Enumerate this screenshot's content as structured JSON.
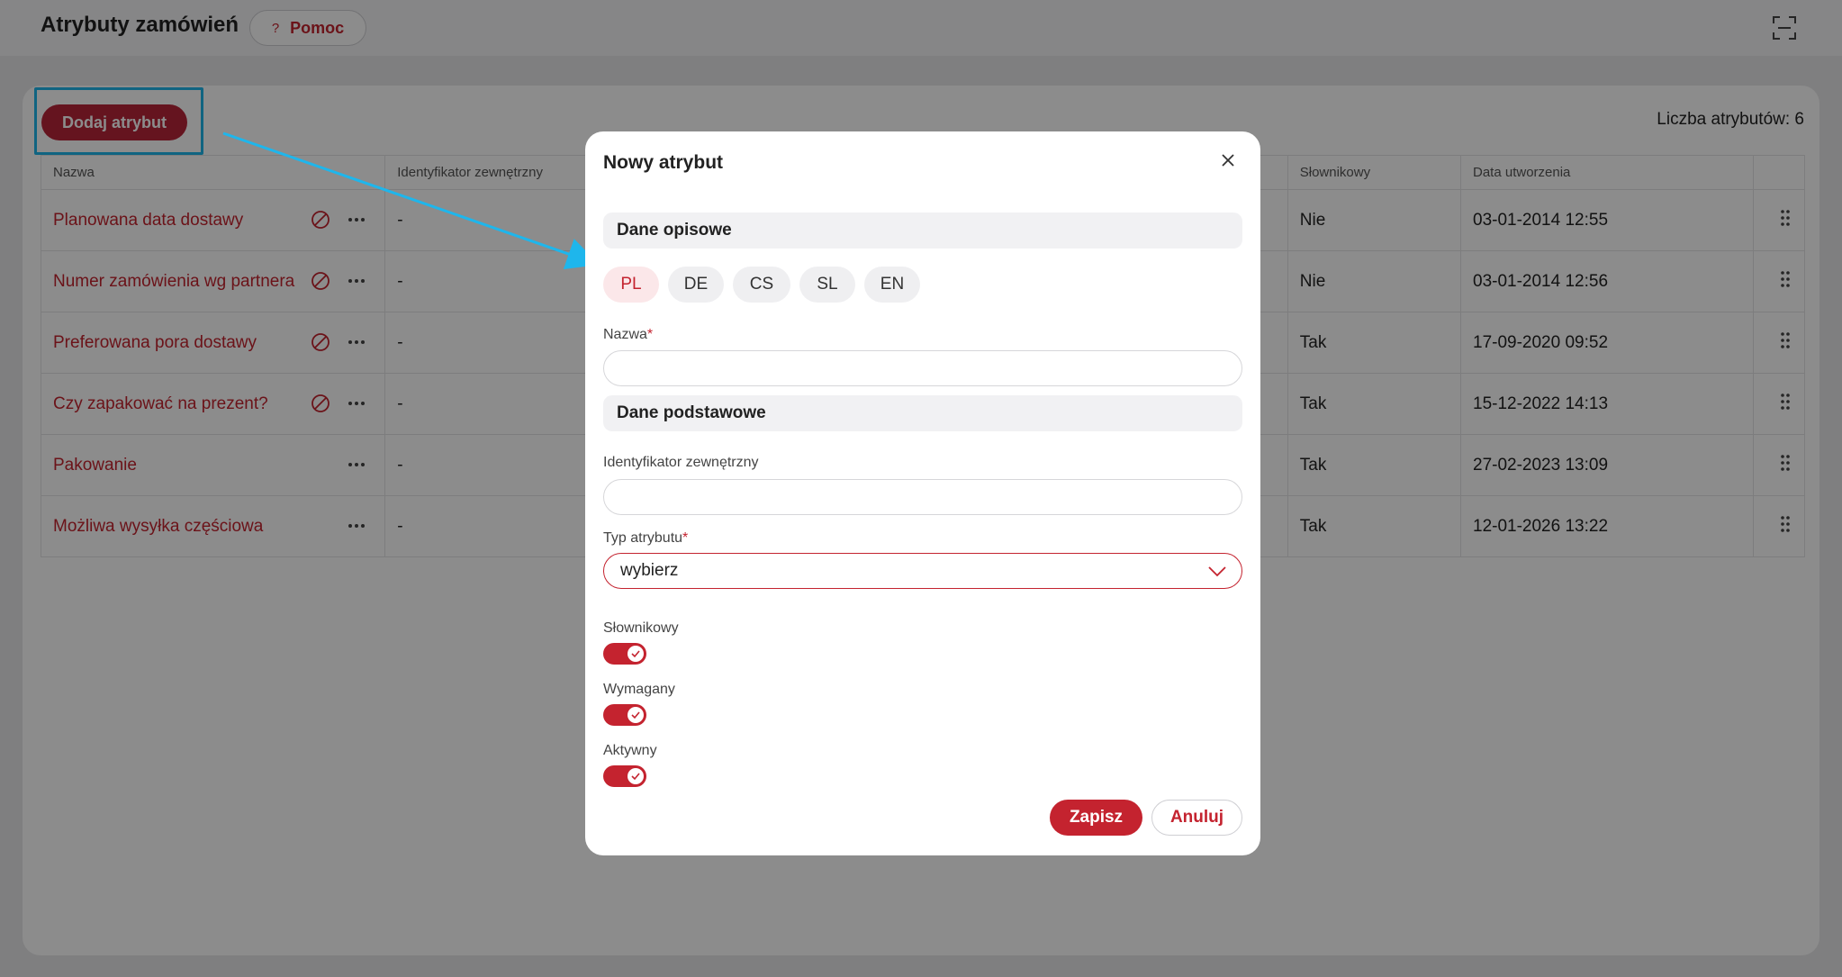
{
  "header": {
    "title": "Atrybuty zamówień",
    "help_icon": "?",
    "help_label": "Pomoc",
    "fullscreen_icon": "fullscreen-icon"
  },
  "toolbar": {
    "add_label": "Dodaj atrybut",
    "count_label": "Liczba atrybutów: 6"
  },
  "table": {
    "columns": [
      "Nazwa",
      "Identyfikator zewnętrzny",
      "",
      "Słownikowy",
      "Data utworzenia",
      ""
    ],
    "rows": [
      {
        "name": "Planowana data dostawy",
        "ext_id": "-",
        "dictionary": "Nie",
        "created": "03-01-2014 12:55",
        "disabled": true
      },
      {
        "name": "Numer zamówienia wg partnera",
        "ext_id": "-",
        "dictionary": "Nie",
        "created": "03-01-2014 12:56",
        "disabled": true
      },
      {
        "name": "Preferowana pora dostawy",
        "ext_id": "-",
        "dictionary": "Tak",
        "created": "17-09-2020 09:52",
        "disabled": true
      },
      {
        "name": "Czy zapakować na prezent?",
        "ext_id": "-",
        "dictionary": "Tak",
        "created": "15-12-2022 14:13",
        "disabled": true
      },
      {
        "name": "Pakowanie",
        "ext_id": "-",
        "dictionary": "Tak",
        "created": "27-02-2023 13:09",
        "disabled": false
      },
      {
        "name": "Możliwa wysyłka częściowa",
        "ext_id": "-",
        "dictionary": "Tak",
        "created": "12-01-2026 13:22",
        "disabled": false
      }
    ]
  },
  "modal": {
    "title": "Nowy atrybut",
    "section_descriptive": "Dane opisowe",
    "languages": [
      "PL",
      "DE",
      "CS",
      "SL",
      "EN"
    ],
    "active_language": "PL",
    "name_label": "Nazwa",
    "name_value": "",
    "section_basic": "Dane podstawowe",
    "ext_id_label": "Identyfikator zewnętrzny",
    "ext_id_value": "",
    "type_label": "Typ atrybutu",
    "type_value": "wybierz",
    "required_mark": "*",
    "toggles": [
      {
        "label": "Słownikowy",
        "on": true
      },
      {
        "label": "Wymagany",
        "on": true
      },
      {
        "label": "Aktywny",
        "on": true
      }
    ],
    "save_label": "Zapisz",
    "cancel_label": "Anuluj"
  },
  "colors": {
    "accent": "#c4232f",
    "highlight": "#1eb6ec"
  }
}
